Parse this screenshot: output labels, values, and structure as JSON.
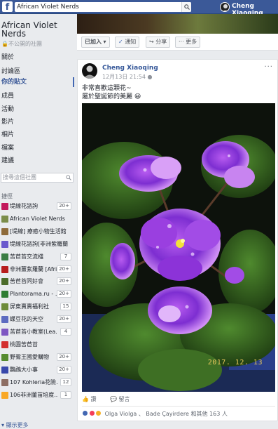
{
  "topbar": {
    "logo": "f",
    "search_value": "African Violet Nerds",
    "user_name": "Cheng Xiaoqing"
  },
  "sidebar": {
    "group_name": "African Violet Nerds",
    "privacy": "不公開的社團",
    "nav": [
      "關於",
      "討論區",
      "你的貼文",
      "成員",
      "活動",
      "影片",
      "相片",
      "檔案",
      "建議"
    ],
    "search_placeholder": "搜尋這個社團",
    "shortcuts_label": "捷徑",
    "shortcuts": [
      {
        "label": "堤線花諮詢",
        "badge": "20+",
        "color": "#c2185b"
      },
      {
        "label": "African Violet Nerds",
        "badge": "",
        "color": "#7b8d4a"
      },
      {
        "label": "[堤線] 療癒小物生活館",
        "badge": "",
        "color": "#8e6b3a"
      },
      {
        "label": "堤線花諮詢[非洲紫羅蘭",
        "badge": "",
        "color": "#6a5acd"
      },
      {
        "label": "苦苣苔交流棧",
        "badge": "7",
        "color": "#3a7d44"
      },
      {
        "label": "非洲薑紫羅蘭 [Afri",
        "badge": "20+",
        "color": "#b71c1c"
      },
      {
        "label": "苦苣苔同好會",
        "badge": "20+",
        "color": "#4b6b2a"
      },
      {
        "label": "Plantorama.ru - ...",
        "badge": "20+",
        "color": "#2e7d32"
      },
      {
        "label": "屏東賣賣福利社",
        "badge": "15",
        "color": "#6d8b3a"
      },
      {
        "label": "蝶豆花的天空",
        "badge": "20+",
        "color": "#5c6bc0"
      },
      {
        "label": "苦苣苔小教室(Lea...",
        "badge": "4",
        "color": "#7e57c2"
      },
      {
        "label": "桃園苦苣苔",
        "badge": "",
        "color": "#d32f2f"
      },
      {
        "label": "野鴛王國愛購物",
        "badge": "20+",
        "color": "#558b2f"
      },
      {
        "label": "鸚鵡大小事",
        "badge": "20+",
        "color": "#3949ab"
      },
      {
        "label": "107 Kohleria花險...",
        "badge": "12",
        "color": "#8d6e63"
      },
      {
        "label": "106非洲菫苗培度...",
        "badge": "1",
        "color": "#f9a825"
      }
    ],
    "see_more": "顯示更多"
  },
  "actionbar": {
    "joined": "已加入",
    "notify": "通知",
    "share": "分享",
    "more": "更多"
  },
  "post": {
    "author": "Cheng Xiaoqing",
    "time": "12月13日 21:54",
    "more": "···",
    "text_line1": "非常喜歡這顆花~",
    "text_line2": "屬於聖誕節的美麗",
    "photo_date": "2017. 12. 13",
    "like": "讚",
    "comment": "留言",
    "reactions_text": "Olga Violga 、 Bade Çayirdere 和其他 163 人"
  }
}
